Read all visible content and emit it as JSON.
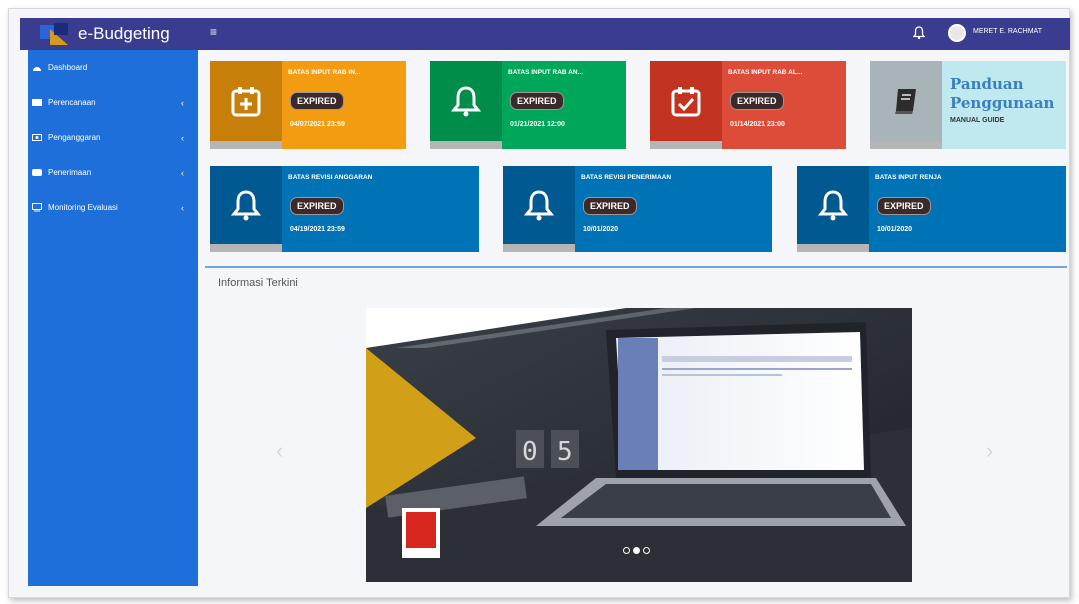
{
  "app": {
    "title": "e-Budgeting",
    "menu_icon": "hamburger-icon",
    "user_name": "MERET E. RACHMAT"
  },
  "sidebar": {
    "items": [
      {
        "label": "Dashboard",
        "icon": "dashboard-icon",
        "has_chevron": false
      },
      {
        "label": "Perencanaan",
        "icon": "list-icon",
        "has_chevron": true
      },
      {
        "label": "Penganggaran",
        "icon": "money-icon",
        "has_chevron": true
      },
      {
        "label": "Penerimaan",
        "icon": "inbox-icon",
        "has_chevron": true
      },
      {
        "label": "Monitoring Evaluasi",
        "icon": "monitor-icon",
        "has_chevron": true
      }
    ]
  },
  "cards_row1": [
    {
      "title": "BATAS INPUT RAB IN...",
      "badge": "EXPIRED",
      "date": "04/07/2021 23:59",
      "color": "#f39c12",
      "dark": "#c87f0a",
      "icon": "calendar-plus-icon"
    },
    {
      "title": "BATAS INPUT RAB AN...",
      "badge": "EXPIRED",
      "date": "01/21/2021 12:00",
      "color": "#00a65a",
      "dark": "#008d4c",
      "icon": "bell-icon"
    },
    {
      "title": "BATAS INPUT RAB AL...",
      "badge": "EXPIRED",
      "date": "01/14/2021 23:00",
      "color": "#dd4b39",
      "dark": "#c23321",
      "icon": "calendar-check-icon"
    }
  ],
  "guide": {
    "title_line1": "Panduan",
    "title_line2": "Penggunaan",
    "subtitle": "MANUAL GUIDE",
    "icon": "book-icon"
  },
  "cards_row2": [
    {
      "title": "BATAS REVISI ANGGARAN",
      "badge": "EXPIRED",
      "date": "04/19/2021 23:59",
      "icon": "bell-icon"
    },
    {
      "title": "BATAS REVISI PENERIMAAN",
      "badge": "EXPIRED",
      "date": "10/01/2020",
      "icon": "bell-icon"
    },
    {
      "title": "BATAS INPUT RENJA",
      "badge": "EXPIRED",
      "date": "10/01/2020",
      "icon": "bell-icon"
    }
  ],
  "row2_color": "#0073b7",
  "row2_dark": "#005a91",
  "news": {
    "title": "Informasi Terkini",
    "slide_count": 3,
    "active_slide": 2
  }
}
